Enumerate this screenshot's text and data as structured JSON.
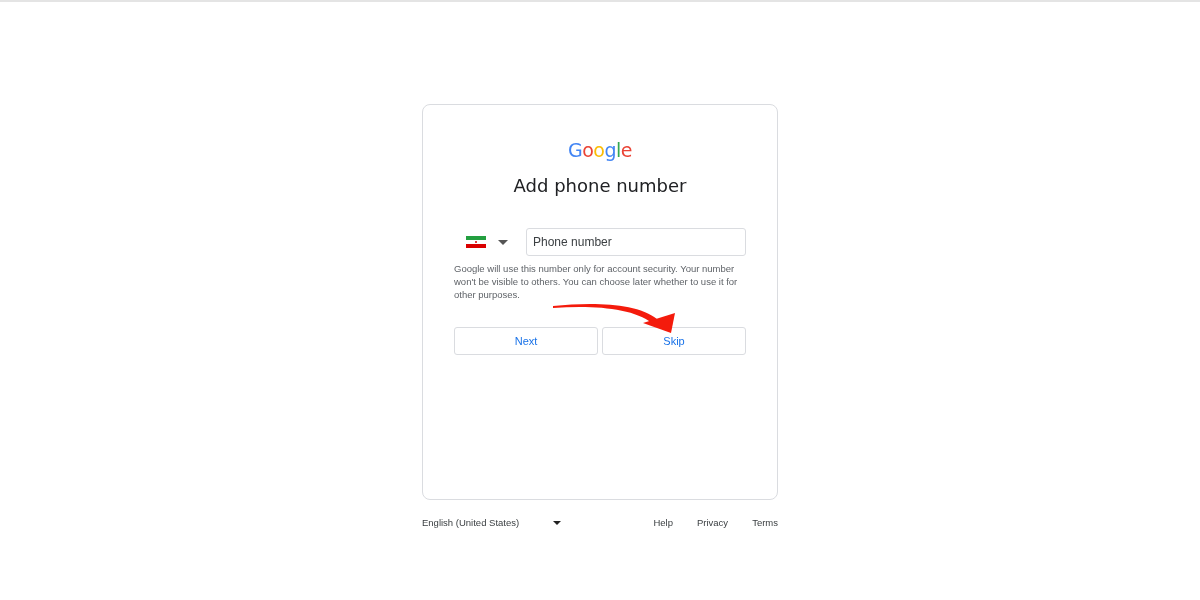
{
  "logo": [
    {
      "char": "G",
      "color": "#4285f4"
    },
    {
      "char": "o",
      "color": "#ea4335"
    },
    {
      "char": "o",
      "color": "#fbbc05"
    },
    {
      "char": "g",
      "color": "#4285f4"
    },
    {
      "char": "l",
      "color": "#34a853"
    },
    {
      "char": "e",
      "color": "#ea4335"
    }
  ],
  "title": "Add phone number",
  "phone": {
    "placeholder": "Phone number"
  },
  "note": "Google will use this number only for account security. Your number won't be visible to others. You can choose later whether to use it for other purposes.",
  "buttons": [
    "Next",
    "Skip"
  ],
  "footer": {
    "language": "English (United States)",
    "links": [
      "Help",
      "Privacy",
      "Terms"
    ]
  }
}
